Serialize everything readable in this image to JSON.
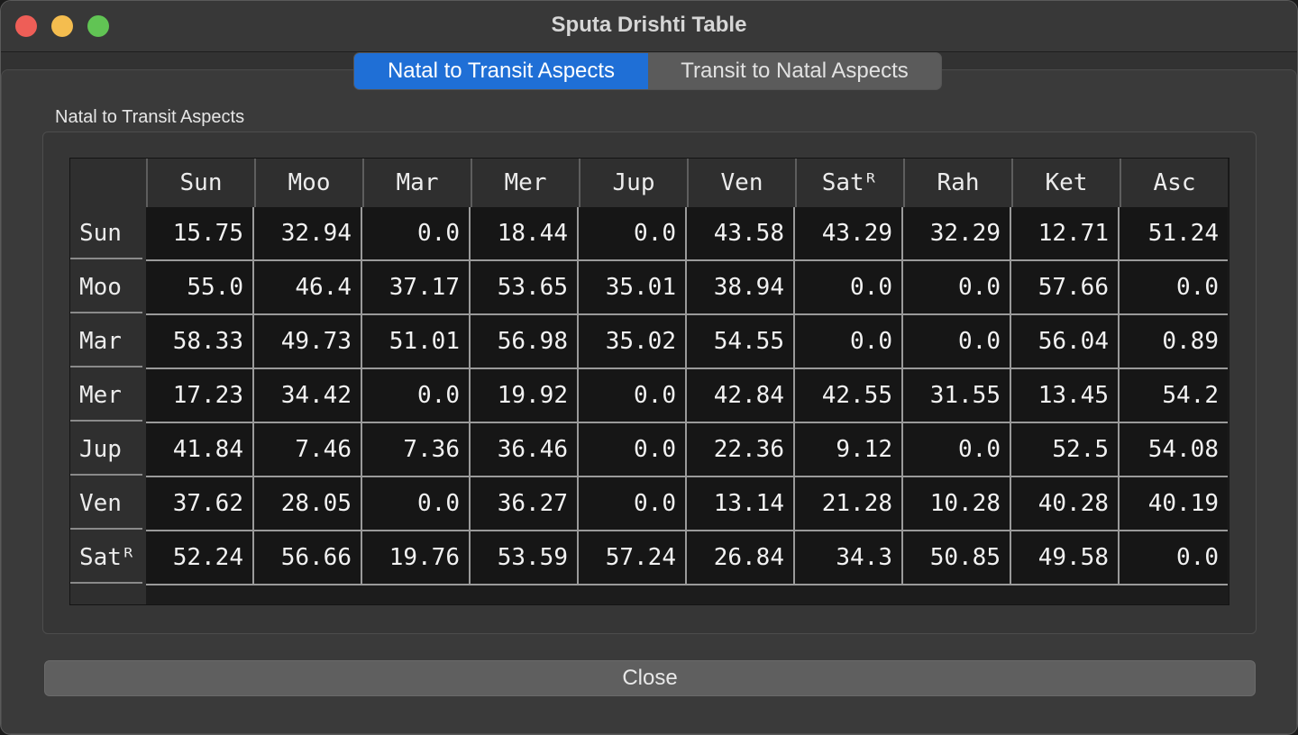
{
  "window": {
    "title": "Sputa Drishti Table"
  },
  "tabs": [
    {
      "label": "Natal to Transit Aspects",
      "active": true
    },
    {
      "label": "Transit to Natal Aspects",
      "active": false
    }
  ],
  "group": {
    "label": "Natal to Transit Aspects"
  },
  "table": {
    "columns": [
      "Sun",
      "Moo",
      "Mar",
      "Mer",
      "Jup",
      "Ven",
      "Satᴿ",
      "Rah",
      "Ket",
      "Asc"
    ],
    "rows": [
      {
        "label": "Sun",
        "cells": [
          "15.75",
          "32.94",
          "0.0",
          "18.44",
          "0.0",
          "43.58",
          "43.29",
          "32.29",
          "12.71",
          "51.24"
        ]
      },
      {
        "label": "Moo",
        "cells": [
          "55.0",
          "46.4",
          "37.17",
          "53.65",
          "35.01",
          "38.94",
          "0.0",
          "0.0",
          "57.66",
          "0.0"
        ]
      },
      {
        "label": "Mar",
        "cells": [
          "58.33",
          "49.73",
          "51.01",
          "56.98",
          "35.02",
          "54.55",
          "0.0",
          "0.0",
          "56.04",
          "0.89"
        ]
      },
      {
        "label": "Mer",
        "cells": [
          "17.23",
          "34.42",
          "0.0",
          "19.92",
          "0.0",
          "42.84",
          "42.55",
          "31.55",
          "13.45",
          "54.2"
        ]
      },
      {
        "label": "Jup",
        "cells": [
          "41.84",
          "7.46",
          "7.36",
          "36.46",
          "0.0",
          "22.36",
          "9.12",
          "0.0",
          "52.5",
          "54.08"
        ]
      },
      {
        "label": "Ven",
        "cells": [
          "37.62",
          "28.05",
          "0.0",
          "36.27",
          "0.0",
          "13.14",
          "21.28",
          "10.28",
          "40.28",
          "40.19"
        ]
      },
      {
        "label": "Satᴿ",
        "cells": [
          "52.24",
          "56.66",
          "19.76",
          "53.59",
          "57.24",
          "26.84",
          "34.3",
          "50.85",
          "49.58",
          "0.0"
        ]
      }
    ]
  },
  "buttons": {
    "close_label": "Close"
  },
  "colors": {
    "accent": "#1f6fd6",
    "close": "#ee5e57",
    "minimize": "#f4bd4f",
    "maximize": "#61c454"
  }
}
